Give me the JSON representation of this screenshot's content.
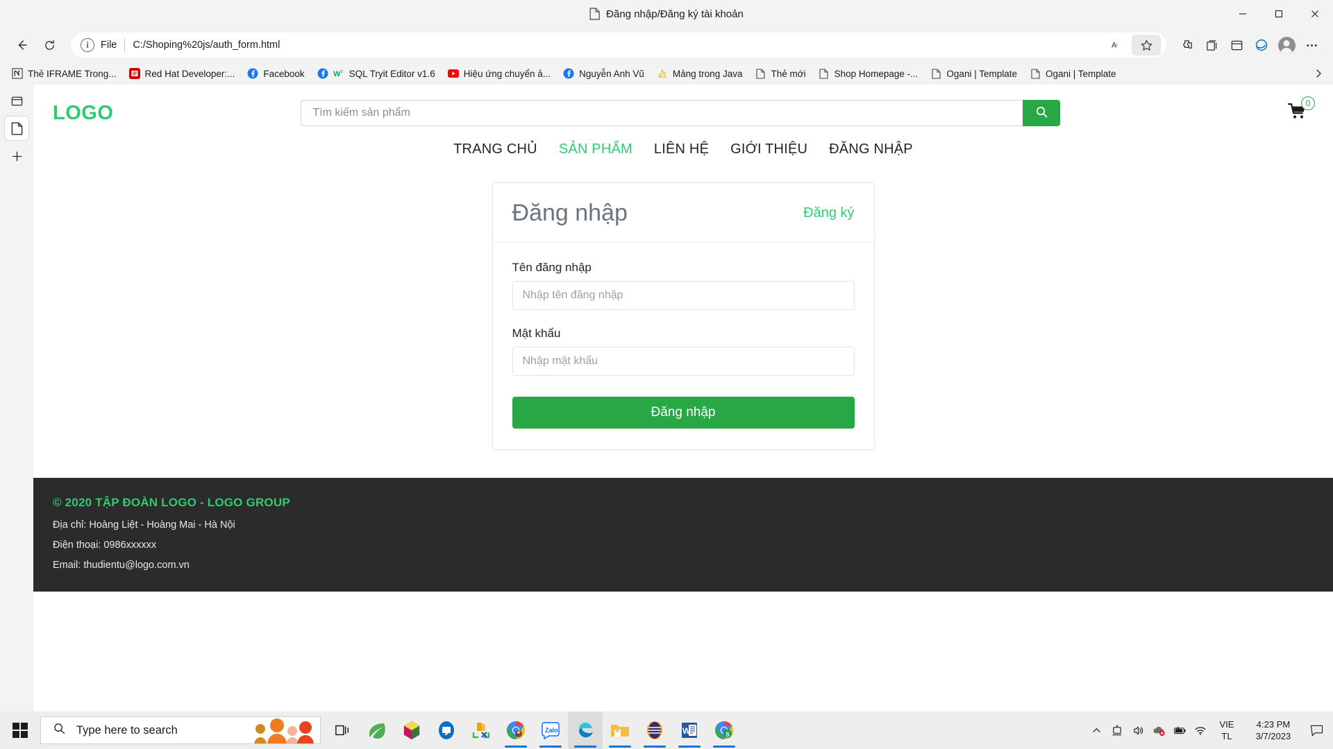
{
  "browser": {
    "tab_title": "Đăng nhập/Đăng ký tài khoản",
    "omnibox": {
      "scheme_label": "File",
      "url": "C:/Shoping%20js/auth_form.html"
    },
    "bookmarks": [
      {
        "label": "Thẻ IFRAME Trong...",
        "icon": "notion-icon"
      },
      {
        "label": "Red Hat Developer:...",
        "icon": "redhat-icon"
      },
      {
        "label": "Facebook",
        "icon": "facebook-icon"
      },
      {
        "label": "SQL Tryit Editor v1.6",
        "icon": "w3schools-icon"
      },
      {
        "label": "Hiệu ứng chuyển ả...",
        "icon": "youtube-icon"
      },
      {
        "label": "Nguyễn Anh Vũ",
        "icon": "facebook-icon"
      },
      {
        "label": "Mảng trong Java",
        "icon": "generic-page-icon"
      },
      {
        "label": "Thẻ mới",
        "icon": "page-icon"
      },
      {
        "label": "Shop Homepage -...",
        "icon": "page-icon"
      },
      {
        "label": "Ogani | Template",
        "icon": "page-icon"
      },
      {
        "label": "Ogani | Template",
        "icon": "page-icon"
      }
    ]
  },
  "site": {
    "logo": "LOGO",
    "search": {
      "placeholder": "Tìm kiếm sản phẩm",
      "value": ""
    },
    "cart_count": "0",
    "nav": [
      {
        "label": "TRANG CHỦ",
        "active": false
      },
      {
        "label": "SẢN PHẨM",
        "active": true
      },
      {
        "label": "LIÊN HỆ",
        "active": false
      },
      {
        "label": "GIỚI THIỆU",
        "active": false
      },
      {
        "label": "ĐĂNG NHẬP",
        "active": false
      }
    ]
  },
  "auth_card": {
    "title": "Đăng nhập",
    "switch_link": "Đăng ký",
    "username": {
      "label": "Tên đăng nhập",
      "placeholder": "Nhập tên đăng nhập",
      "value": ""
    },
    "password": {
      "label": "Mật khẩu",
      "placeholder": "Nhập mật khẩu",
      "value": ""
    },
    "submit_label": "Đăng nhập"
  },
  "footer": {
    "copyright": "© 2020 TẬP ĐOÀN LOGO - LOGO GROUP",
    "address": "Địa chỉ: Hoàng Liệt - Hoàng Mai - Hà Nội",
    "phone": "Điện thoại: 0986xxxxxx",
    "email": "Email: thudientu@logo.com.vn"
  },
  "taskbar": {
    "search_placeholder": "Type here to search",
    "language_line1": "VIE",
    "language_line2": "TL",
    "time": "4:23 PM",
    "date": "3/7/2023"
  },
  "colors": {
    "brand_green": "#2ecc71",
    "button_green": "#28a745",
    "footer_bg": "#2b2b2b"
  }
}
